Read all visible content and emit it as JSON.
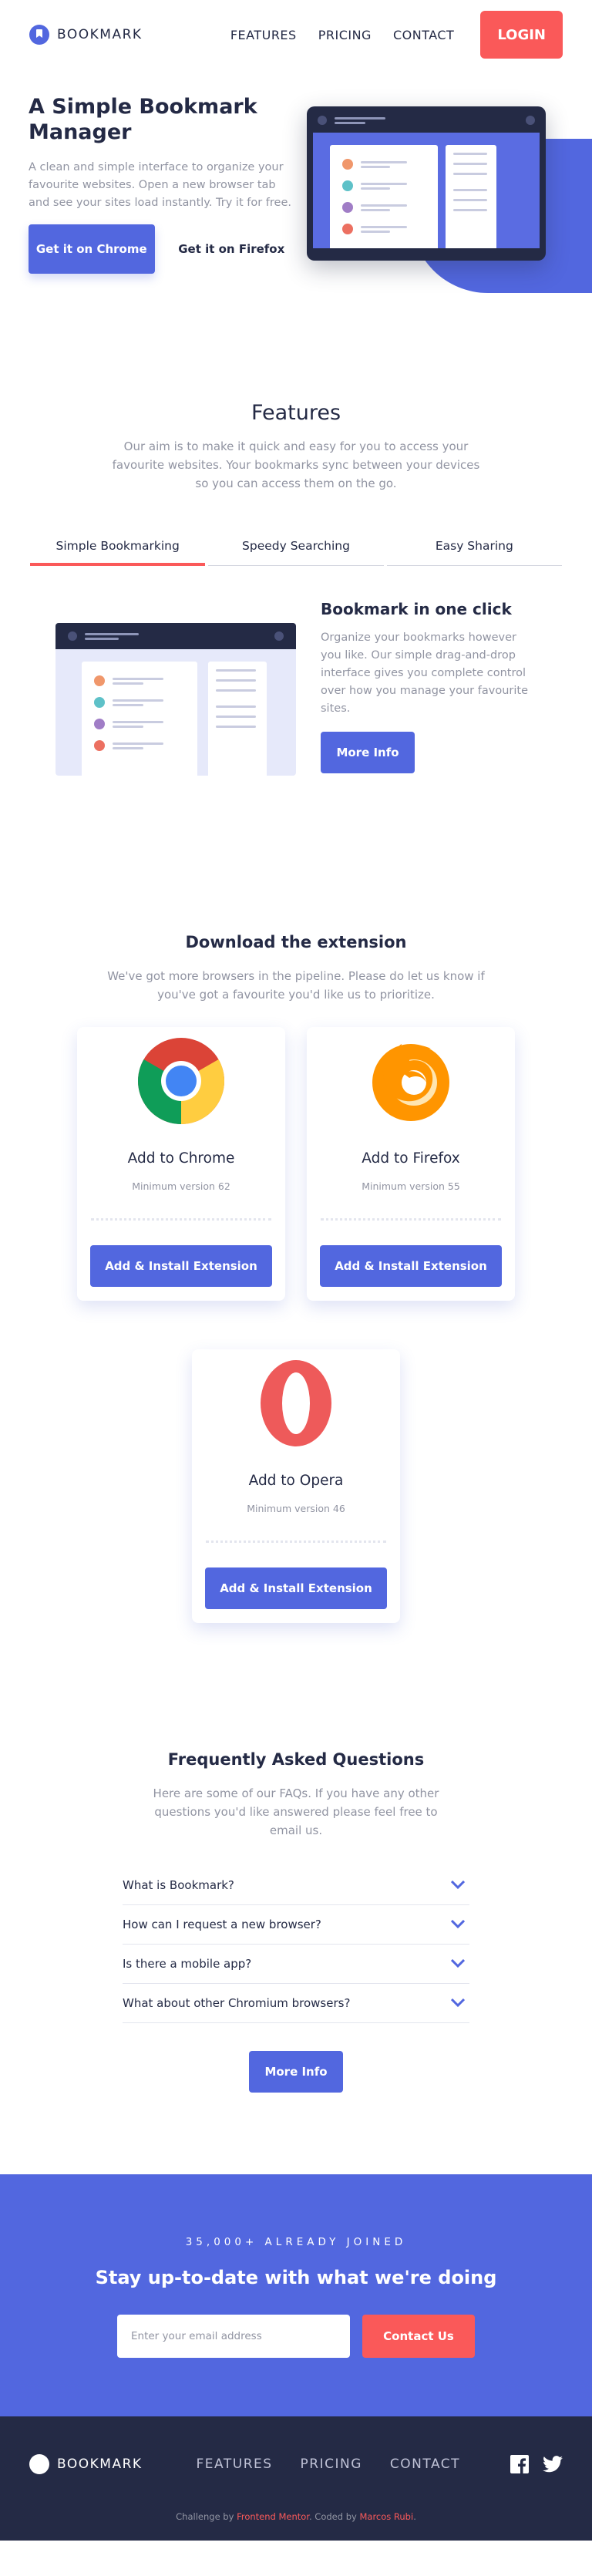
{
  "nav": {
    "logo_text": "BOOKMARK",
    "links": [
      "FEATURES",
      "PRICING",
      "CONTACT"
    ],
    "login_label": "LOGIN"
  },
  "hero": {
    "title": "A Simple Bookmark Manager",
    "description": "A clean and simple interface to organize your favourite websites. Open a new browser tab and see your sites load instantly. Try it for free.",
    "primary_button": "Get it on Chrome",
    "secondary_button": "Get it on Firefox"
  },
  "features": {
    "title": "Features",
    "description": "Our aim is to make it quick and easy for you to access your favourite websites. Your bookmarks sync between your devices so you can access them on the go.",
    "tabs": [
      "Simple Bookmarking",
      "Speedy Searching",
      "Easy Sharing"
    ],
    "active_tab": "Simple Bookmarking",
    "panel": {
      "title": "Bookmark in one click",
      "description": "Organize your bookmarks however you like. Our simple drag-and-drop interface gives you complete control over how you manage your favourite sites.",
      "button": "More Info"
    }
  },
  "download": {
    "title": "Download the extension",
    "description": "We've got more browsers in the pipeline. Please do let us know if you've got a favourite you'd like us to prioritize.",
    "cards": [
      {
        "name": "Add to Chrome",
        "version": "Minimum version 62",
        "button": "Add & Install Extension",
        "icon": "chrome-logo-icon"
      },
      {
        "name": "Add to Firefox",
        "version": "Minimum version 55",
        "button": "Add & Install Extension",
        "icon": "firefox-logo-icon"
      },
      {
        "name": "Add to Opera",
        "version": "Minimum version 46",
        "button": "Add & Install Extension",
        "icon": "opera-logo-icon"
      }
    ]
  },
  "faq": {
    "title": "Frequently Asked Questions",
    "description": "Here are some of our FAQs. If you have any other questions you'd like answered please feel free to email us.",
    "questions": [
      "What is Bookmark?",
      "How can I request a new browser?",
      "Is there a mobile app?",
      "What about other Chromium browsers?"
    ],
    "button": "More Info"
  },
  "cta": {
    "kicker": "35,000+ ALREADY JOINED",
    "title": "Stay up-to-date with what we're doing",
    "email_placeholder": "Enter your email address",
    "button": "Contact Us"
  },
  "footer": {
    "logo_text": "BOOKMARK",
    "links": [
      "FEATURES",
      "PRICING",
      "CONTACT"
    ],
    "attribution_prefix": "Challenge by ",
    "attribution_org": "Frontend Mentor",
    "attribution_mid": ". Coded by ",
    "attribution_author": "Marcos Rubi",
    "attribution_suffix": ".",
    "social": [
      "facebook-icon",
      "twitter-icon"
    ]
  },
  "colors": {
    "primary": "#5267DF",
    "accent": "#FA5959",
    "dark": "#242A45",
    "grey": "#9194A2"
  }
}
